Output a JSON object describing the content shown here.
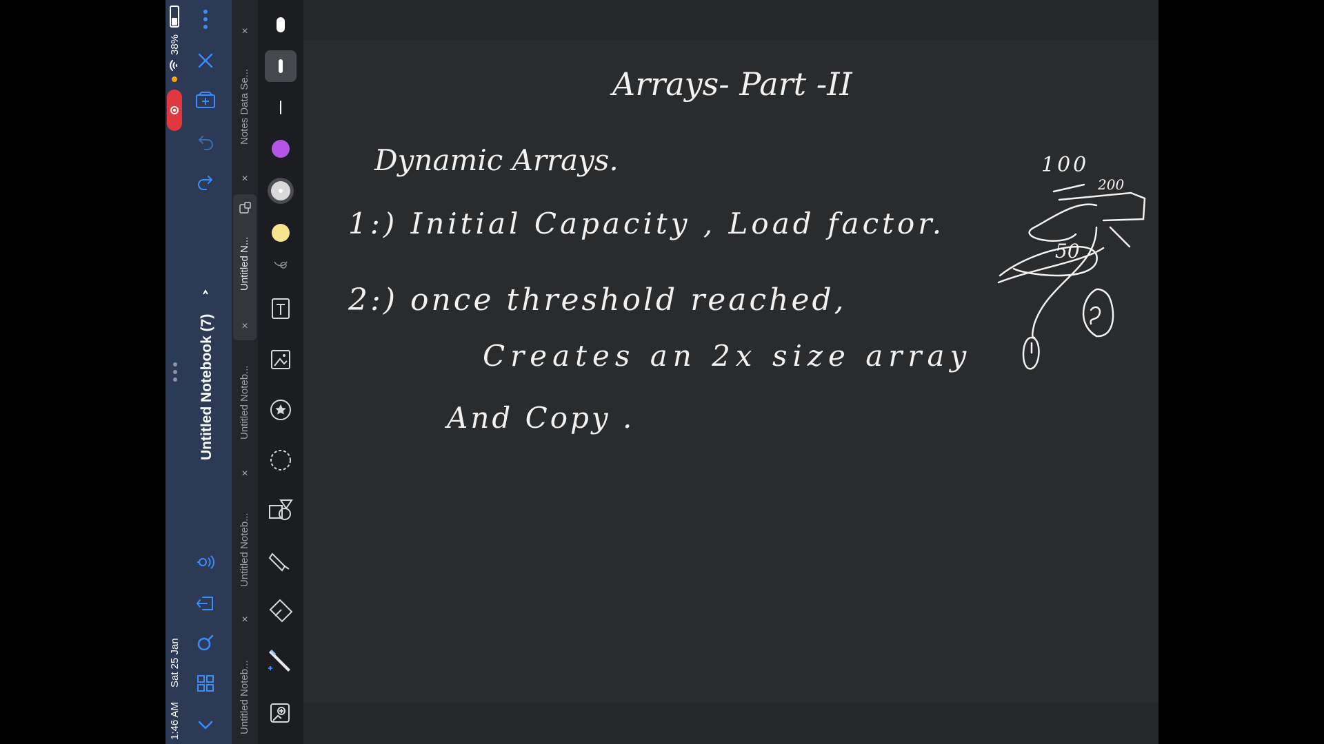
{
  "status": {
    "time": "1:46 AM",
    "date": "Sat 25 Jan",
    "battery": "38%"
  },
  "sidebar": {
    "notebook_title": "Untitled Notebook (7)",
    "icons": [
      "more-icon",
      "close-icon",
      "add-page-icon",
      "undo-icon",
      "redo-icon",
      "pages-icon",
      "drag-handle-icon",
      "read-aloud-icon",
      "exit-icon",
      "search-icon",
      "grid-icon",
      "chevron-down-icon"
    ]
  },
  "tabs": [
    {
      "label": "Notes Data Se...",
      "active": false
    },
    {
      "label": "Untitled N...",
      "active": true
    },
    {
      "label": "Untitled Noteb...",
      "active": false
    },
    {
      "label": "Untitled Noteb...",
      "active": false
    },
    {
      "label": "Untitled Noteb...",
      "active": false
    }
  ],
  "toolbar": {
    "pen_colors": [
      "#ffffff",
      "#b455e8",
      "#d9d9d9",
      "#f6e58d"
    ],
    "tools": [
      "pen-size-thick",
      "pen-size-medium",
      "pen-size-thin",
      "color-white",
      "color-purple",
      "color-gray",
      "color-yellow",
      "lasso-collapse",
      "text-tool",
      "image-tool",
      "sticker-tool",
      "lasso-tool",
      "shapes-tool",
      "highlighter-tool",
      "eraser-tool",
      "pen-tool",
      "add-image-tool"
    ]
  },
  "canvas": {
    "title": "Arrays- Part -II",
    "line1": "Dynamic Arrays.",
    "line2": "1:) Initial Capacity , Load factor.",
    "line3": "2:) once threshold reached,",
    "line4": "Creates an 2x size array",
    "line5": "And Copy .",
    "side_100": "100",
    "side_200": "200",
    "side_50": "50"
  }
}
